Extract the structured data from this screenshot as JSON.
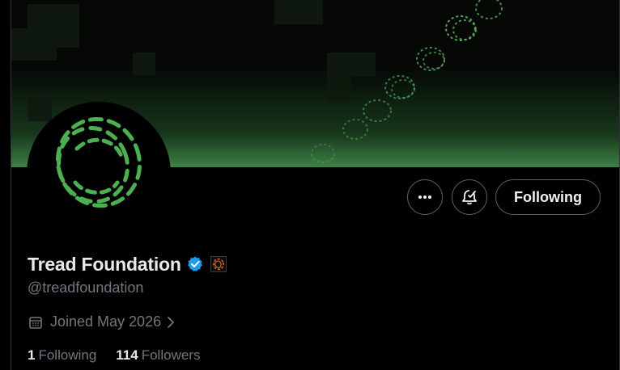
{
  "profile": {
    "display_name": "Tread Foundation",
    "handle": "@treadfoundation",
    "joined": "Joined May 2026",
    "verified_icon": "verified-badge-icon",
    "affiliate_icon": "affiliate-logo-icon"
  },
  "actions": {
    "more_icon": "more-horizontal-icon",
    "notify_icon": "bell-check-icon",
    "following_label": "Following"
  },
  "stats": {
    "following_count": "1",
    "following_label": "Following",
    "followers_count": "114",
    "followers_label": "Followers"
  },
  "colors": {
    "background": "#000000",
    "accent_green": "#4caf50",
    "verified_blue": "#1d9bf0",
    "secondary_text": "#71767b",
    "button_border": "#536471"
  }
}
